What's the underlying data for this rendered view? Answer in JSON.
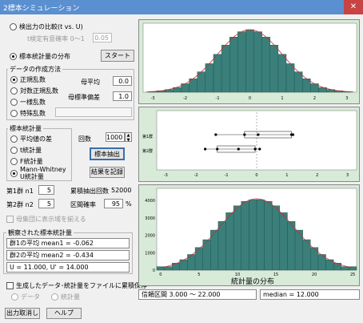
{
  "window": {
    "title": "2標本シミュレーション",
    "close": "✕"
  },
  "compare": {
    "label": "検出力の比較(t vs. U)",
    "sig_label": "t検定有意確率 0〜1",
    "sig_value": "0.05"
  },
  "distribution": {
    "label": "標本統計量の分布",
    "start": "スタート"
  },
  "data_method": {
    "title": "データの作成方法",
    "options": [
      "正規乱数",
      "対数正規乱数",
      "一様乱数",
      "特殊乱数"
    ],
    "mean_label": "母平均",
    "mean_value": "0.0",
    "sd_label": "母標準偏差",
    "sd_value": "1.0"
  },
  "statistic": {
    "title": "標本統計量",
    "options": [
      "平均値の差",
      "t統計量",
      "F統計量",
      "Mann-Whitney\nU統計量"
    ]
  },
  "sampling": {
    "count_label": "回数",
    "count_value": "1000",
    "extract": "標本抽出",
    "record": "結果を記録"
  },
  "groups": {
    "n1_label": "第1群 n1",
    "n1_value": "5",
    "n2_label": "第2群 n2",
    "n2_value": "5",
    "total_label": "累積抽出回数",
    "total_value": "52000",
    "ci_label": "区間確率",
    "ci_value": "95",
    "ci_unit": "%"
  },
  "show_region": {
    "label": "母集団に表示域を揃える"
  },
  "observed": {
    "title": "観察された標本統計量",
    "g1": "群1の平均 mean1 = -0.062",
    "g2": "群2の平均 mean2 = -0.434",
    "u": "U = 11.000, U' = 14.000"
  },
  "save": {
    "label": "生成したデータ･統計量をファイルに累積保存",
    "opt1": "データ",
    "opt2": "統計量"
  },
  "buttons": {
    "cancel": "出力取消し",
    "help": "ヘルプ"
  },
  "footer": {
    "interval": "信頼区間 3.000 〜 22.000",
    "median": "median = 12.000"
  },
  "charts": {
    "top": {
      "xticks": [
        "-3",
        "-2",
        "-1",
        "0",
        "1",
        "2",
        "3"
      ]
    },
    "mid": {
      "xticks": [
        "-3",
        "-2",
        "-1",
        "0",
        "1",
        "2",
        "3"
      ],
      "ylabel1": "第1群",
      "ylabel2": "第2群"
    },
    "bottom": {
      "xlabel": "統計量の分布",
      "yticks": [
        "0",
        "1000",
        "2000",
        "3000",
        "4000"
      ],
      "xticks": [
        "0",
        "5",
        "10",
        "15",
        "20",
        "25"
      ]
    }
  },
  "chart_data": [
    {
      "type": "bar",
      "x": [
        -3,
        -2.75,
        -2.5,
        -2.25,
        -2,
        -1.75,
        -1.5,
        -1.25,
        -1,
        -0.75,
        -0.5,
        -0.25,
        0,
        0.25,
        0.5,
        0.75,
        1,
        1.25,
        1.5,
        1.75,
        2,
        2.25,
        2.5,
        2.75,
        3
      ],
      "values": [
        0.004,
        0.009,
        0.017,
        0.03,
        0.054,
        0.086,
        0.13,
        0.182,
        0.242,
        0.301,
        0.352,
        0.386,
        0.399,
        0.386,
        0.352,
        0.301,
        0.242,
        0.182,
        0.13,
        0.086,
        0.054,
        0.03,
        0.017,
        0.009,
        0.004
      ],
      "xlim": [
        -3.3,
        3.3
      ]
    },
    {
      "type": "scatter",
      "series": [
        {
          "name": "第1群",
          "values": [
            -1.35,
            -0.4,
            0.05,
            1.15,
            1.2
          ]
        },
        {
          "name": "第2群",
          "values": [
            -1.7,
            -1.3,
            -0.6,
            -0.05,
            0.1
          ]
        }
      ],
      "xlim": [
        -3.3,
        3.3
      ]
    },
    {
      "type": "bar",
      "categories": [
        0,
        1,
        2,
        3,
        4,
        5,
        6,
        7,
        8,
        9,
        10,
        11,
        12,
        13,
        14,
        15,
        16,
        17,
        18,
        19,
        20,
        21,
        22,
        23,
        24,
        25
      ],
      "values": [
        200,
        200,
        400,
        600,
        900,
        1300,
        1750,
        2300,
        2800,
        3300,
        3700,
        3950,
        4050,
        4050,
        3950,
        3700,
        3300,
        2800,
        2300,
        1750,
        1300,
        900,
        600,
        400,
        200,
        200
      ],
      "ylim": [
        0,
        4700
      ],
      "xlim": [
        -0.5,
        25.5
      ],
      "xlabel": "統計量の分布"
    }
  ]
}
